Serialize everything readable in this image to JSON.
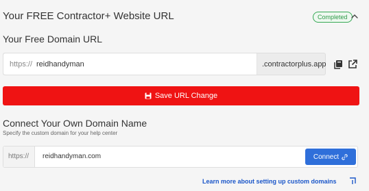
{
  "header": {
    "title": "Your FREE Contractor+ Website URL",
    "status_badge": "Completed",
    "toggle_icon": "chevron-up-icon"
  },
  "free_url": {
    "title": "Your Free Domain URL",
    "prefix": "https://",
    "value": "reidhandyman",
    "suffix": ".contractorplus.app",
    "copy_icon": "copy-icon",
    "open_icon": "external-link-icon"
  },
  "save_button": {
    "label": "Save URL Change",
    "icon": "save-icon",
    "color": "#ef1313"
  },
  "custom_domain": {
    "title": "Connect Your Own Domain Name",
    "description": "Specify the custom domain for your help center",
    "prefix": "https://",
    "value": "reidhandyman.com",
    "connect_label": "Connect",
    "connect_icon": "link-icon",
    "connect_color": "#2f6fda"
  },
  "learn_more": {
    "label": "Learn more about setting up custom domains",
    "icon": "external-link-corner-icon"
  }
}
